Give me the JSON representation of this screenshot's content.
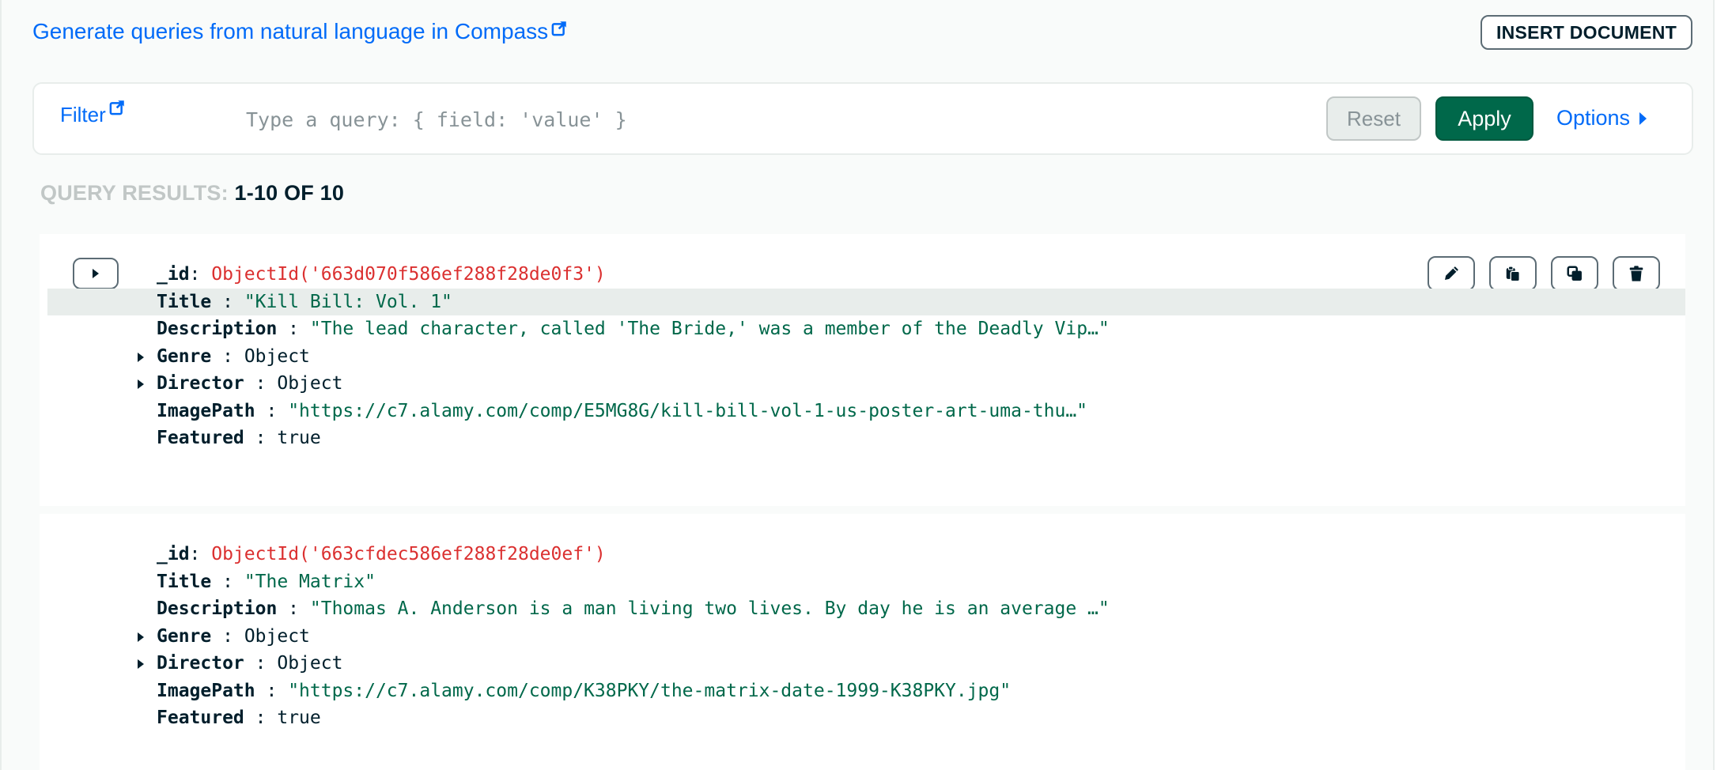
{
  "header": {
    "compass_link": "Generate queries from natural language in Compass",
    "insert_button": "INSERT DOCUMENT"
  },
  "filter": {
    "label": "Filter",
    "placeholder": "Type a query: { field: 'value' }",
    "value": "",
    "reset_label": "Reset",
    "apply_label": "Apply",
    "options_label": "Options"
  },
  "results": {
    "label": "QUERY RESULTS:",
    "count": "1-10 OF 10"
  },
  "documents": [
    {
      "fields": [
        {
          "key": "_id",
          "sep": ":",
          "value": "ObjectId('663d070f586ef288f28de0f3')",
          "type": "id"
        },
        {
          "key": "Title",
          "sep": " :",
          "value": "\"Kill Bill: Vol. 1\"",
          "type": "string"
        },
        {
          "key": "Description",
          "sep": " :",
          "value": "\"The lead character, called 'The Bride,' was a member of the Deadly Vip…\"",
          "type": "string"
        },
        {
          "key": "Genre",
          "sep": " :",
          "value": "Object",
          "type": "object"
        },
        {
          "key": "Director",
          "sep": " :",
          "value": "Object",
          "type": "object"
        },
        {
          "key": "ImagePath",
          "sep": " :",
          "value": "\"https://c7.alamy.com/comp/E5MG8G/kill-bill-vol-1-us-poster-art-uma-thu…\"",
          "type": "string"
        },
        {
          "key": "Featured",
          "sep": " :",
          "value": "true",
          "type": "bool"
        }
      ]
    },
    {
      "fields": [
        {
          "key": "_id",
          "sep": ":",
          "value": "ObjectId('663cfdec586ef288f28de0ef')",
          "type": "id"
        },
        {
          "key": "Title",
          "sep": " :",
          "value": "\"The Matrix\"",
          "type": "string"
        },
        {
          "key": "Description",
          "sep": " :",
          "value": "\"Thomas A. Anderson is a man living two lives. By day he is an average …\"",
          "type": "string"
        },
        {
          "key": "Genre",
          "sep": " :",
          "value": "Object",
          "type": "object"
        },
        {
          "key": "Director",
          "sep": " :",
          "value": "Object",
          "type": "object"
        },
        {
          "key": "ImagePath",
          "sep": " :",
          "value": "\"https://c7.alamy.com/comp/K38PKY/the-matrix-date-1999-K38PKY.jpg\"",
          "type": "string"
        },
        {
          "key": "Featured",
          "sep": " :",
          "value": "true",
          "type": "bool"
        }
      ]
    }
  ],
  "document_actions": [
    "pencil-icon",
    "clone-icon",
    "copy-icon",
    "trash-icon"
  ],
  "colors": {
    "link": "#016bf8",
    "apply_bg": "#00684a",
    "id_value": "#db3030",
    "string_value": "#00684a",
    "highlight_row": "#e8edeb"
  }
}
